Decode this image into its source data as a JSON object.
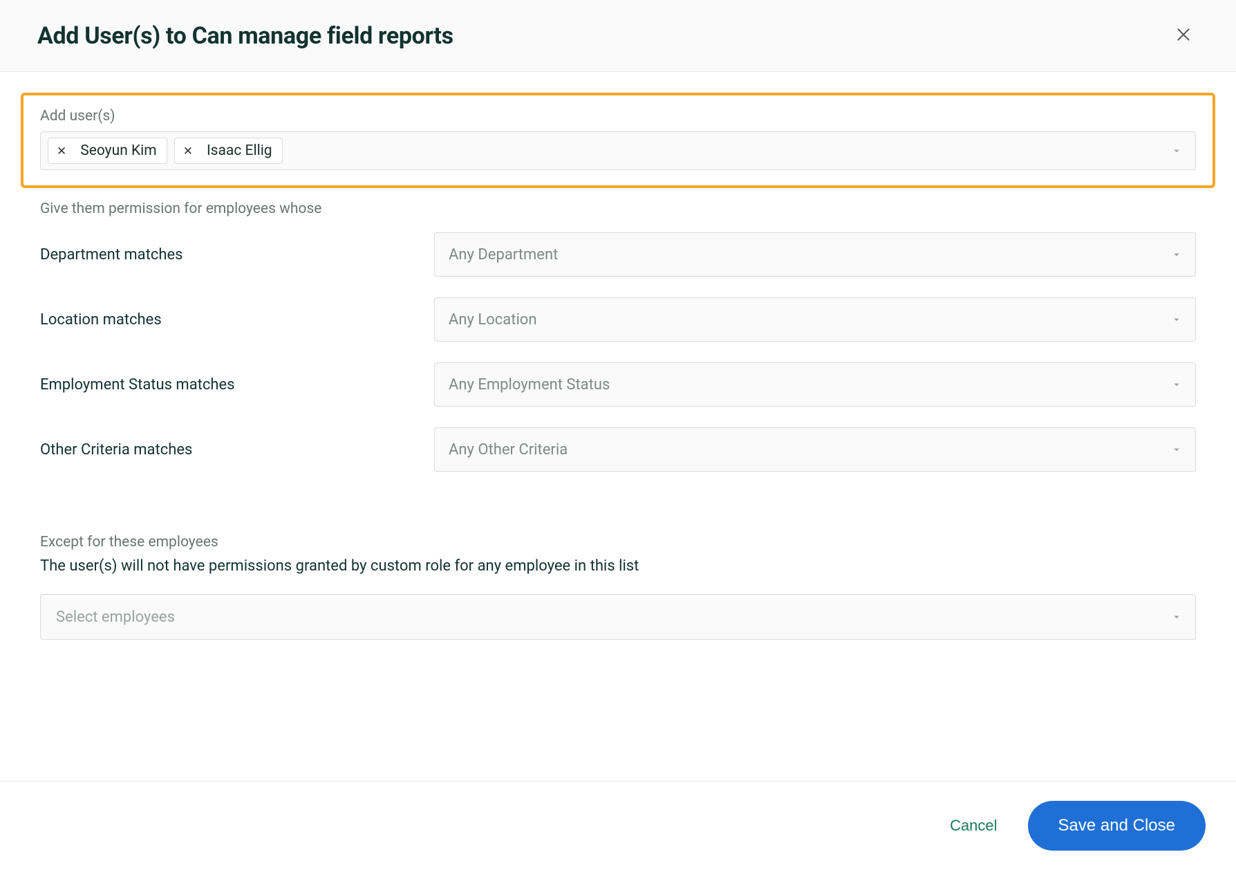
{
  "header": {
    "title": "Add User(s) to Can manage field reports"
  },
  "addUsers": {
    "label": "Add user(s)",
    "chips": [
      {
        "name": "Seoyun Kim"
      },
      {
        "name": "Isaac Ellig"
      }
    ]
  },
  "permissionHint": "Give them permission for employees whose",
  "criteria": [
    {
      "label": "Department matches",
      "placeholder": "Any Department"
    },
    {
      "label": "Location matches",
      "placeholder": "Any Location"
    },
    {
      "label": "Employment Status matches",
      "placeholder": "Any Employment Status"
    },
    {
      "label": "Other Criteria matches",
      "placeholder": "Any Other Criteria"
    }
  ],
  "except": {
    "header": "Except for these employees",
    "subtext": "The user(s) will not have permissions granted by custom role for any employee in this list",
    "placeholder": "Select employees"
  },
  "footer": {
    "cancel": "Cancel",
    "save": "Save and Close"
  }
}
